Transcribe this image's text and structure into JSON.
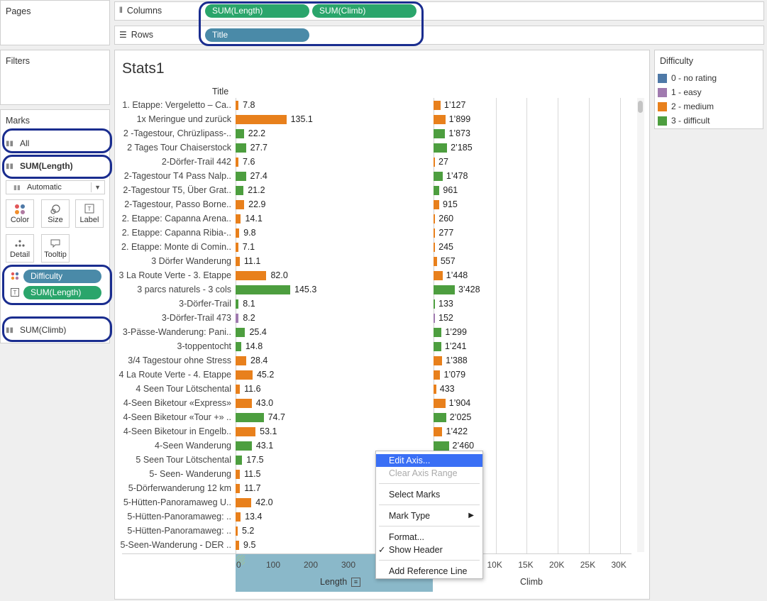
{
  "pages": {
    "title": "Pages"
  },
  "filters": {
    "title": "Filters"
  },
  "columns_shelf": {
    "label": "Columns",
    "pills": [
      "SUM(Length)",
      "SUM(Climb)"
    ]
  },
  "rows_shelf": {
    "label": "Rows",
    "pills": [
      "Title"
    ]
  },
  "marks": {
    "title": "Marks",
    "all": "All",
    "sum_length": "SUM(Length)",
    "mark_type": "Automatic",
    "buttons": {
      "color": "Color",
      "size": "Size",
      "label": "Label",
      "detail": "Detail",
      "tooltip": "Tooltip"
    },
    "fields": {
      "difficulty": "Difficulty",
      "sum_length": "SUM(Length)"
    },
    "sum_climb": "SUM(Climb)"
  },
  "sheet": {
    "title": "Stats1",
    "row_header": "Title"
  },
  "legend": {
    "title": "Difficulty",
    "items": [
      {
        "label": "0 - no rating",
        "color": "#4e79a7"
      },
      {
        "label": "1 - easy",
        "color": "#a07aaf"
      },
      {
        "label": "2 - medium",
        "color": "#e8801c"
      },
      {
        "label": "3 - difficult",
        "color": "#4d9e3f"
      }
    ]
  },
  "chart_data": {
    "type": "bar",
    "categories": [
      "1. Etappe: Vergeletto – Ca..",
      "1x Meringue und zurück",
      "2 -Tagestour, Chrüzlipass-..",
      "2 Tages Tour Chaiserstock",
      "2-Dörfer-Trail 442",
      "2-Tagestour T4 Pass Nalp..",
      "2-Tagestour T5, Über Grat..",
      "2-Tagestour,  Passo Borne..",
      "2. Etappe: Capanna Arena..",
      "2. Etappe: Capanna Ribia-..",
      "2. Etappe: Monte di Comin..",
      "3 Dörfer Wanderung",
      "3 La Route Verte - 3. Etappe",
      "3 parcs naturels - 3 cols",
      "3-Dörfer-Trail",
      "3-Dörfer-Trail 473",
      "3-Pässe-Wanderung: Pani..",
      "3-toppentocht",
      "3/4 Tagestour ohne Stress",
      "4 La Route Verte - 4. Etappe",
      "4 Seen Tour Lötschental",
      "4-Seen Biketour «Express»",
      "4-Seen Biketour «Tour +» ..",
      "4-Seen Biketour in Engelb..",
      "4-Seen Wanderung",
      "5 Seen Tour Lötschental",
      "5- Seen- Wanderung",
      "5-Dörferwanderung 12 km",
      "5-Hütten-Panoramaweg U..",
      "5-Hütten-Panoramaweg: ..",
      "5-Hütten-Panoramaweg: ..",
      "5-Seen-Wanderung - DER .."
    ],
    "difficulty": [
      2,
      2,
      3,
      3,
      2,
      3,
      3,
      2,
      2,
      2,
      2,
      2,
      2,
      3,
      3,
      1,
      3,
      3,
      2,
      2,
      2,
      2,
      3,
      2,
      3,
      3,
      2,
      2,
      2,
      2,
      2,
      2
    ],
    "series": [
      {
        "name": "Length",
        "values": [
          7.8,
          135.1,
          22.2,
          27.7,
          7.6,
          27.4,
          21.2,
          22.9,
          14.1,
          9.8,
          7.1,
          11.1,
          82.0,
          145.3,
          8.1,
          8.2,
          25.4,
          14.8,
          28.4,
          45.2,
          11.6,
          43.0,
          74.7,
          53.1,
          43.1,
          17.5,
          11.5,
          11.7,
          42.0,
          13.4,
          5.2,
          9.5
        ],
        "labels": [
          "7.8",
          "135.1",
          "22.2",
          "27.7",
          "7.6",
          "27.4",
          "21.2",
          "22.9",
          "14.1",
          "9.8",
          "7.1",
          "11.1",
          "82.0",
          "145.3",
          "8.1",
          "8.2",
          "25.4",
          "14.8",
          "28.4",
          "45.2",
          "11.6",
          "43.0",
          "74.7",
          "53.1",
          "43.1",
          "17.5",
          "11.5",
          "11.7",
          "42.0",
          "13.4",
          "5.2",
          "9.5"
        ]
      },
      {
        "name": "Climb",
        "values": [
          1127,
          1899,
          1873,
          2185,
          27,
          1478,
          961,
          915,
          260,
          277,
          245,
          557,
          1448,
          3428,
          133,
          152,
          1299,
          1241,
          1388,
          1079,
          433,
          1904,
          2025,
          1422,
          2460,
          null,
          null,
          null,
          null,
          null,
          null,
          null
        ],
        "labels": [
          "1’127",
          "1’899",
          "1’873",
          "2’185",
          "27",
          "1’478",
          "961",
          "915",
          "260",
          "277",
          "245",
          "557",
          "1’448",
          "3’428",
          "133",
          "152",
          "1’299",
          "1’241",
          "1’388",
          "1’079",
          "433",
          "1’904",
          "2’025",
          "1’422",
          "2’460",
          "",
          "",
          "",
          "",
          "",
          "",
          ""
        ]
      }
    ],
    "length_axis": {
      "title": "Length",
      "ticks": [
        "0",
        "100",
        "200",
        "300"
      ]
    },
    "climb_axis": {
      "title": "Climb",
      "ticks": [
        "10K",
        "15K",
        "20K",
        "25K",
        "30K"
      ]
    }
  },
  "context_menu": {
    "edit_axis": "Edit Axis...",
    "clear_axis_range": "Clear Axis Range",
    "select_marks": "Select Marks",
    "mark_type": "Mark Type",
    "format": "Format...",
    "show_header": "Show Header",
    "add_reference_line": "Add Reference Line"
  }
}
